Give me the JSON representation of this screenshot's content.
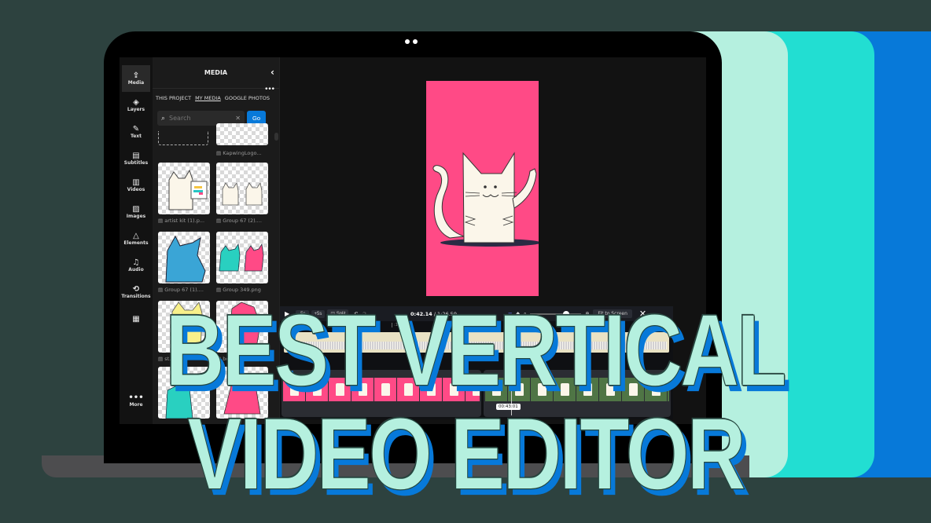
{
  "background_cards": {
    "colors": [
      "#b5f0df",
      "#22ded2",
      "#0779d9"
    ]
  },
  "sidebar": {
    "items": [
      {
        "label": "Media",
        "icon": "upload-cloud-icon",
        "glyph": "⇪",
        "active": true
      },
      {
        "label": "Layers",
        "icon": "layers-icon",
        "glyph": "◈"
      },
      {
        "label": "Text",
        "icon": "edit-text-icon",
        "glyph": "✎"
      },
      {
        "label": "Subtitles",
        "icon": "subtitles-icon",
        "glyph": "▤"
      },
      {
        "label": "Videos",
        "icon": "film-icon",
        "glyph": "▥"
      },
      {
        "label": "Images",
        "icon": "image-icon",
        "glyph": "▨"
      },
      {
        "label": "Elements",
        "icon": "shapes-icon",
        "glyph": "△"
      },
      {
        "label": "Audio",
        "icon": "music-note-icon",
        "glyph": "♫"
      },
      {
        "label": "Transitions",
        "icon": "loop-icon",
        "glyph": "⟲"
      },
      {
        "label": "",
        "icon": "grid-icon",
        "glyph": "▦"
      },
      {
        "label": "More",
        "icon": "more-dots-icon",
        "glyph": "•••"
      }
    ]
  },
  "media_panel": {
    "title": "MEDIA",
    "back_glyph": "‹",
    "more_glyph": "•••",
    "tabs": [
      "THIS PROJECT",
      "MY MEDIA",
      "GOOGLE PHOTOS"
    ],
    "active_tab": "MY MEDIA",
    "search": {
      "placeholder": "Search",
      "value": "",
      "clear_glyph": "✕",
      "go_label": "Go"
    },
    "items": [
      {
        "name": "",
        "kind": "upload-placeholder"
      },
      {
        "name": "KapwingLogo..."
      },
      {
        "name": "artist kit (1).p..."
      },
      {
        "name": "Group 67 (2)...."
      },
      {
        "name": "Group 67 (1)...."
      },
      {
        "name": "Group 349.png"
      },
      {
        "name": "st..."
      },
      {
        "name": "bob..."
      },
      {
        "name": ""
      },
      {
        "name": ""
      }
    ]
  },
  "preview": {
    "background": "#ff4a86"
  },
  "timeline": {
    "play_glyph": "▶",
    "back_label": "-5s",
    "forward_label": "+5s",
    "split_label": "Split",
    "undo_glyph": "↶",
    "redo_glyph": "↷",
    "current_time": "0:42.14",
    "total_time": "1:26.59",
    "zoom_fraction": 0.7,
    "fit_label": "Fit to Screen",
    "close_glyph": "✕",
    "ruler_ticks": [
      ":16",
      ":36"
    ],
    "playhead_time": "00:43:01",
    "clips": [
      {
        "color": "#ff4a86",
        "frames": 10
      },
      {
        "color": "#4f7545",
        "frames": 10
      }
    ]
  },
  "headline": {
    "line1": "BEST VERTICAL",
    "line2": "VIDEO EDITOR"
  }
}
